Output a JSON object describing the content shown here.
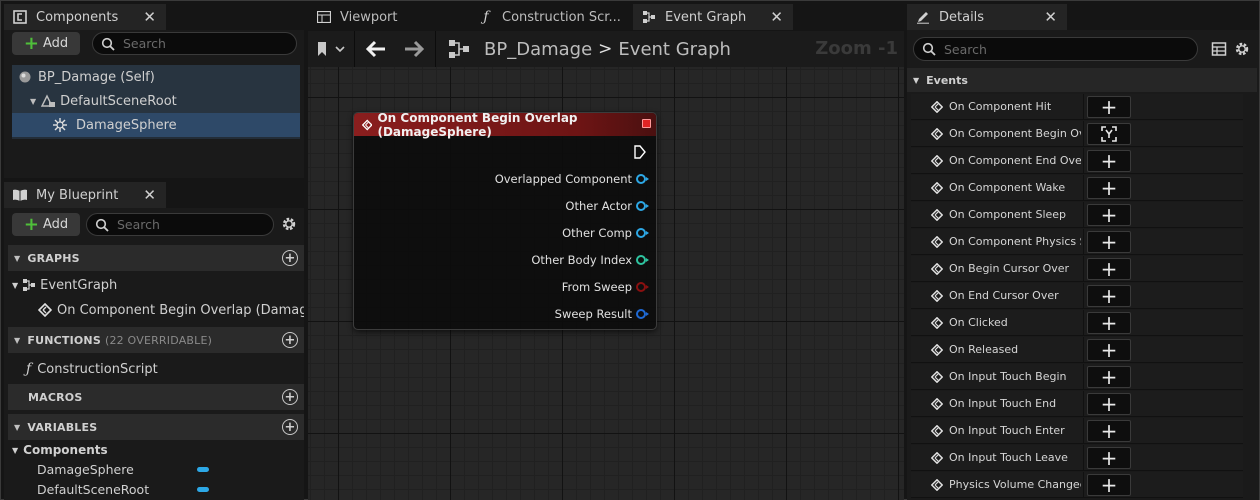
{
  "components_panel": {
    "tab_label": "Components",
    "add_label": "Add",
    "search_placeholder": "Search",
    "tree": [
      {
        "label": "BP_Damage (Self)"
      },
      {
        "label": "DefaultSceneRoot"
      },
      {
        "label": "DamageSphere"
      }
    ]
  },
  "my_blueprint": {
    "tab_label": "My Blueprint",
    "add_label": "Add",
    "search_placeholder": "Search",
    "graphs_header": "GRAPHS",
    "event_graph_label": "EventGraph",
    "event_item_label": "On Component Begin Overlap (DamageSphere)",
    "functions_header": "FUNCTIONS",
    "functions_sub": "(22 OVERRIDABLE)",
    "construction_script_label": "ConstructionScript",
    "macros_header": "MACROS",
    "variables_header": "VARIABLES",
    "components_category": "Components",
    "variables": [
      "DamageSphere",
      "DefaultSceneRoot"
    ]
  },
  "editor_tabs": [
    {
      "label": "Viewport"
    },
    {
      "label": "Construction Scr..."
    },
    {
      "label": "Event Graph"
    }
  ],
  "graph": {
    "breadcrumb_bp": "BP_Damage",
    "breadcrumb_sep": ">",
    "breadcrumb_graph": "Event Graph",
    "zoom_label": "Zoom -1",
    "node_title": "On Component Begin Overlap (DamageSphere)",
    "pins": [
      {
        "label": "Overlapped Component",
        "color": "#2da8e6"
      },
      {
        "label": "Other Actor",
        "color": "#2da8e6"
      },
      {
        "label": "Other Comp",
        "color": "#2da8e6"
      },
      {
        "label": "Other Body Index",
        "color": "#2ec4a0"
      },
      {
        "label": "From Sweep",
        "color": "#8a1010"
      },
      {
        "label": "Sweep Result",
        "color": "#1f6ad6"
      }
    ]
  },
  "details_panel": {
    "tab_label": "Details",
    "search_placeholder": "Search",
    "events_header": "Events",
    "events": [
      "On Component Hit",
      "On Component Begin Overlap",
      "On Component End Overlap",
      "On Component Wake",
      "On Component Sleep",
      "On Component Physics State Changed",
      "On Begin Cursor Over",
      "On End Cursor Over",
      "On Clicked",
      "On Released",
      "On Input Touch Begin",
      "On Input Touch End",
      "On Input Touch Enter",
      "On Input Touch Leave",
      "Physics Volume Changed"
    ]
  }
}
